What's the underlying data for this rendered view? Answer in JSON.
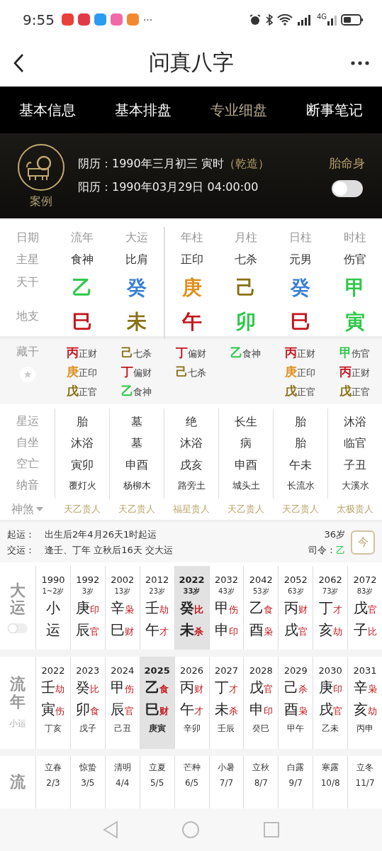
{
  "status_bar": {
    "time": "9:55",
    "more": "···",
    "network": "4G"
  },
  "header": {
    "title": "问真八字"
  },
  "tabs": [
    {
      "label": "基本信息",
      "selected": false
    },
    {
      "label": "基本排盘",
      "selected": false
    },
    {
      "label": "专业细盘",
      "selected": true
    },
    {
      "label": "断事笔记",
      "selected": false
    }
  ],
  "profile": {
    "badge": "案例",
    "lunar_label": "阴历：",
    "lunar": "1990年三月初三 寅时",
    "gender_tag": "（乾造）",
    "solar_label": "阳历：",
    "solar": "1990年03月29日 04:00:00",
    "toggle_label": "胎命身",
    "toggle_on": false
  },
  "pillars": {
    "row_labels": [
      "日期",
      "主星",
      "天干",
      "地支"
    ],
    "columns": [
      {
        "kind": "luck",
        "header": "流年",
        "star": "食神",
        "stem": {
          "text": "乙",
          "color": "#2ec84a"
        },
        "branch": {
          "text": "巳",
          "color": "#c4161c"
        }
      },
      {
        "kind": "luck",
        "header": "大运",
        "star": "比肩",
        "stem": {
          "text": "癸",
          "color": "#3a7fd5"
        },
        "branch": {
          "text": "未",
          "color": "#8a7015"
        }
      },
      {
        "kind": "natal",
        "header": "年柱",
        "star": "正印",
        "stem": {
          "text": "庚",
          "color": "#e0901e"
        },
        "branch": {
          "text": "午",
          "color": "#c4161c"
        }
      },
      {
        "kind": "natal",
        "header": "月柱",
        "star": "七杀",
        "stem": {
          "text": "己",
          "color": "#8a7015"
        },
        "branch": {
          "text": "卯",
          "color": "#2ec84a"
        }
      },
      {
        "kind": "natal",
        "header": "日柱",
        "star": "元男",
        "stem": {
          "text": "癸",
          "color": "#3a7fd5"
        },
        "branch": {
          "text": "巳",
          "color": "#c4161c"
        }
      },
      {
        "kind": "natal",
        "header": "时柱",
        "star": "伤官",
        "stem": {
          "text": "甲",
          "color": "#2ec84a"
        },
        "branch": {
          "text": "寅",
          "color": "#2ec84a"
        }
      }
    ]
  },
  "hidden_stems": {
    "label": "藏干",
    "columns": [
      [
        {
          "stem": "丙",
          "color": "#c4161c",
          "god": "正财"
        },
        {
          "stem": "庚",
          "color": "#e0901e",
          "god": "正印"
        },
        {
          "stem": "戊",
          "color": "#8a7015",
          "god": "正官"
        }
      ],
      [
        {
          "stem": "己",
          "color": "#8a7015",
          "god": "七杀"
        },
        {
          "stem": "丁",
          "color": "#c4161c",
          "god": "偏财"
        },
        {
          "stem": "乙",
          "color": "#2ec84a",
          "god": "食神"
        }
      ],
      [
        {
          "stem": "丁",
          "color": "#c4161c",
          "god": "偏财"
        },
        {
          "stem": "己",
          "color": "#8a7015",
          "god": "七杀"
        }
      ],
      [
        {
          "stem": "乙",
          "color": "#2ec84a",
          "god": "食神"
        }
      ],
      [
        {
          "stem": "丙",
          "color": "#c4161c",
          "god": "正财"
        },
        {
          "stem": "庚",
          "color": "#e0901e",
          "god": "正印"
        },
        {
          "stem": "戊",
          "color": "#8a7015",
          "god": "正官"
        }
      ],
      [
        {
          "stem": "甲",
          "color": "#2ec84a",
          "god": "伤官"
        },
        {
          "stem": "丙",
          "color": "#c4161c",
          "god": "正财"
        },
        {
          "stem": "戊",
          "color": "#8a7015",
          "god": "正官"
        }
      ]
    ]
  },
  "rows": [
    {
      "label": "星运",
      "values": [
        "胎",
        "墓",
        "绝",
        "长生",
        "胎",
        "沐浴"
      ]
    },
    {
      "label": "自坐",
      "values": [
        "沐浴",
        "墓",
        "沐浴",
        "病",
        "胎",
        "临官"
      ]
    },
    {
      "label": "空亡",
      "values": [
        "寅卯",
        "申酉",
        "戌亥",
        "申酉",
        "午未",
        "子丑"
      ]
    },
    {
      "label": "纳音",
      "values": [
        "覆灯火",
        "杨柳木",
        "路旁土",
        "城头土",
        "长流水",
        "大溪水"
      ]
    }
  ],
  "shensha": {
    "label": "神煞",
    "values": [
      "天乙贵人",
      "天乙贵人",
      "福星贵人",
      "天乙贵人",
      "天乙贵人",
      "太极贵人"
    ]
  },
  "qiyun": {
    "lines": [
      {
        "label": "起运：",
        "text": "出生后2年4月26天1时起运"
      },
      {
        "label": "交运：",
        "text": "逢壬、丁年 立秋后16天 交大运"
      }
    ],
    "age": "36岁",
    "siling_label": "司令：",
    "siling": {
      "text": "乙",
      "color": "#2ec84a"
    },
    "today": "今"
  },
  "dayun": {
    "label": "大运",
    "toggle_on": false,
    "items": [
      {
        "year": "1990",
        "age": "1~2岁",
        "stem": "小",
        "branch": "运",
        "selected": false
      },
      {
        "year": "1992",
        "age": "3岁",
        "stem": "庚",
        "stem_god": "印",
        "branch": "辰",
        "branch_god": "官",
        "selected": false
      },
      {
        "year": "2002",
        "age": "13岁",
        "stem": "辛",
        "stem_god": "枭",
        "branch": "巳",
        "branch_god": "财",
        "selected": false
      },
      {
        "year": "2012",
        "age": "23岁",
        "stem": "壬",
        "stem_god": "劫",
        "branch": "午",
        "branch_god": "才",
        "selected": false
      },
      {
        "year": "2022",
        "age": "33岁",
        "stem": "癸",
        "stem_god": "比",
        "branch": "未",
        "branch_god": "杀",
        "selected": true
      },
      {
        "year": "2032",
        "age": "43岁",
        "stem": "甲",
        "stem_god": "伤",
        "branch": "申",
        "branch_god": "印",
        "selected": false
      },
      {
        "year": "2042",
        "age": "53岁",
        "stem": "乙",
        "stem_god": "食",
        "branch": "酉",
        "branch_god": "枭",
        "selected": false
      },
      {
        "year": "2052",
        "age": "63岁",
        "stem": "丙",
        "stem_god": "财",
        "branch": "戌",
        "branch_god": "官",
        "selected": false
      },
      {
        "year": "2062",
        "age": "73岁",
        "stem": "丁",
        "stem_god": "才",
        "branch": "亥",
        "branch_god": "劫",
        "selected": false
      },
      {
        "year": "2072",
        "age": "83岁",
        "stem": "戊",
        "stem_god": "官",
        "branch": "子",
        "branch_god": "比",
        "selected": false
      }
    ]
  },
  "liunian": {
    "label": "流年",
    "sub_label": "小运",
    "items": [
      {
        "year": "2022",
        "stem": "壬",
        "stem_god": "劫",
        "branch": "寅",
        "branch_god": "伤",
        "xiaoyun": "丁亥",
        "selected": false
      },
      {
        "year": "2023",
        "stem": "癸",
        "stem_god": "比",
        "branch": "卯",
        "branch_god": "食",
        "xiaoyun": "戊子",
        "selected": false
      },
      {
        "year": "2024",
        "stem": "甲",
        "stem_god": "伤",
        "branch": "辰",
        "branch_god": "官",
        "xiaoyun": "己丑",
        "selected": false
      },
      {
        "year": "2025",
        "stem": "乙",
        "stem_god": "食",
        "branch": "巳",
        "branch_god": "财",
        "xiaoyun": "庚寅",
        "selected": true
      },
      {
        "year": "2026",
        "stem": "丙",
        "stem_god": "财",
        "branch": "午",
        "branch_god": "才",
        "xiaoyun": "辛卯",
        "selected": false
      },
      {
        "year": "2027",
        "stem": "丁",
        "stem_god": "才",
        "branch": "未",
        "branch_god": "杀",
        "xiaoyun": "壬辰",
        "selected": false
      },
      {
        "year": "2028",
        "stem": "戊",
        "stem_god": "官",
        "branch": "申",
        "branch_god": "印",
        "xiaoyun": "癸巳",
        "selected": false
      },
      {
        "year": "2029",
        "stem": "己",
        "stem_god": "杀",
        "branch": "酉",
        "branch_god": "枭",
        "xiaoyun": "甲午",
        "selected": false
      },
      {
        "year": "2030",
        "stem": "庚",
        "stem_god": "印",
        "branch": "戌",
        "branch_god": "官",
        "xiaoyun": "乙未",
        "selected": false
      },
      {
        "year": "2031",
        "stem": "辛",
        "stem_god": "枭",
        "branch": "亥",
        "branch_god": "劫",
        "xiaoyun": "丙申",
        "selected": false
      }
    ]
  },
  "liuyue": {
    "label": "流",
    "items": [
      {
        "term": "立春",
        "date": "2/3"
      },
      {
        "term": "惊蛰",
        "date": "3/5"
      },
      {
        "term": "清明",
        "date": "4/4"
      },
      {
        "term": "立夏",
        "date": "5/5"
      },
      {
        "term": "芒种",
        "date": "6/5"
      },
      {
        "term": "小暑",
        "date": "7/7"
      },
      {
        "term": "立秋",
        "date": "8/7"
      },
      {
        "term": "白露",
        "date": "9/7"
      },
      {
        "term": "寒露",
        "date": "10/8"
      },
      {
        "term": "立冬",
        "date": "11/7"
      }
    ]
  }
}
